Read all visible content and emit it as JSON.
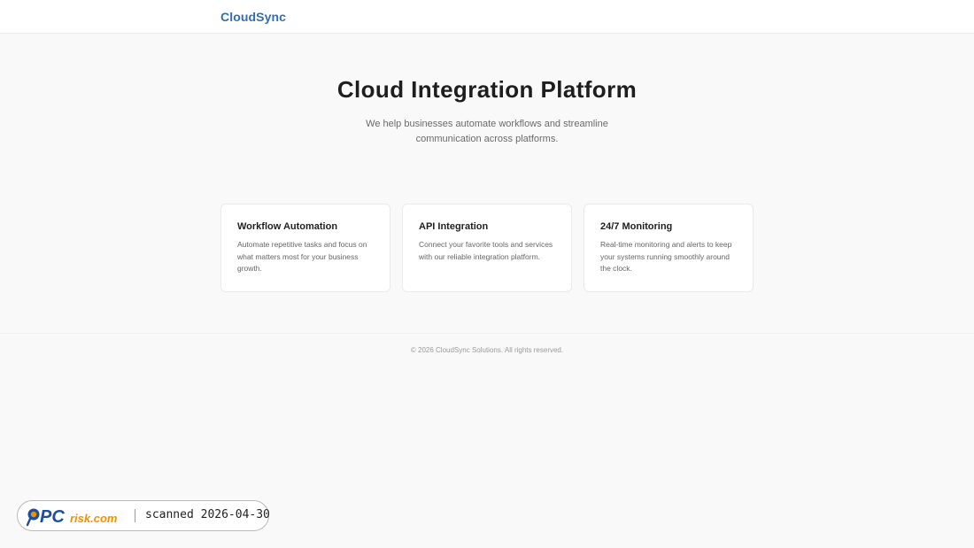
{
  "header": {
    "brand": "CloudSync"
  },
  "hero": {
    "title": "Cloud Integration Platform",
    "subtitle": "We help businesses automate workflows and streamline communication across platforms."
  },
  "features": [
    {
      "title": "Workflow Automation",
      "text": "Automate repetitive tasks and focus on what matters most for your business growth."
    },
    {
      "title": "API Integration",
      "text": "Connect your favorite tools and services with our reliable integration platform."
    },
    {
      "title": "24/7 Monitoring",
      "text": "Real-time monitoring and alerts to keep your systems running smoothly around the clock."
    }
  ],
  "footer": {
    "copyright": "© 2026 CloudSync Solutions. All rights reserved."
  },
  "scan_badge": {
    "logo_text": "PCrisk.com",
    "label": "scanned 2026-04-30"
  },
  "colors": {
    "brand": "#2f6eb5",
    "background": "#f9f9fa",
    "logo_blue": "#1f4e9c",
    "logo_orange": "#f39200"
  }
}
